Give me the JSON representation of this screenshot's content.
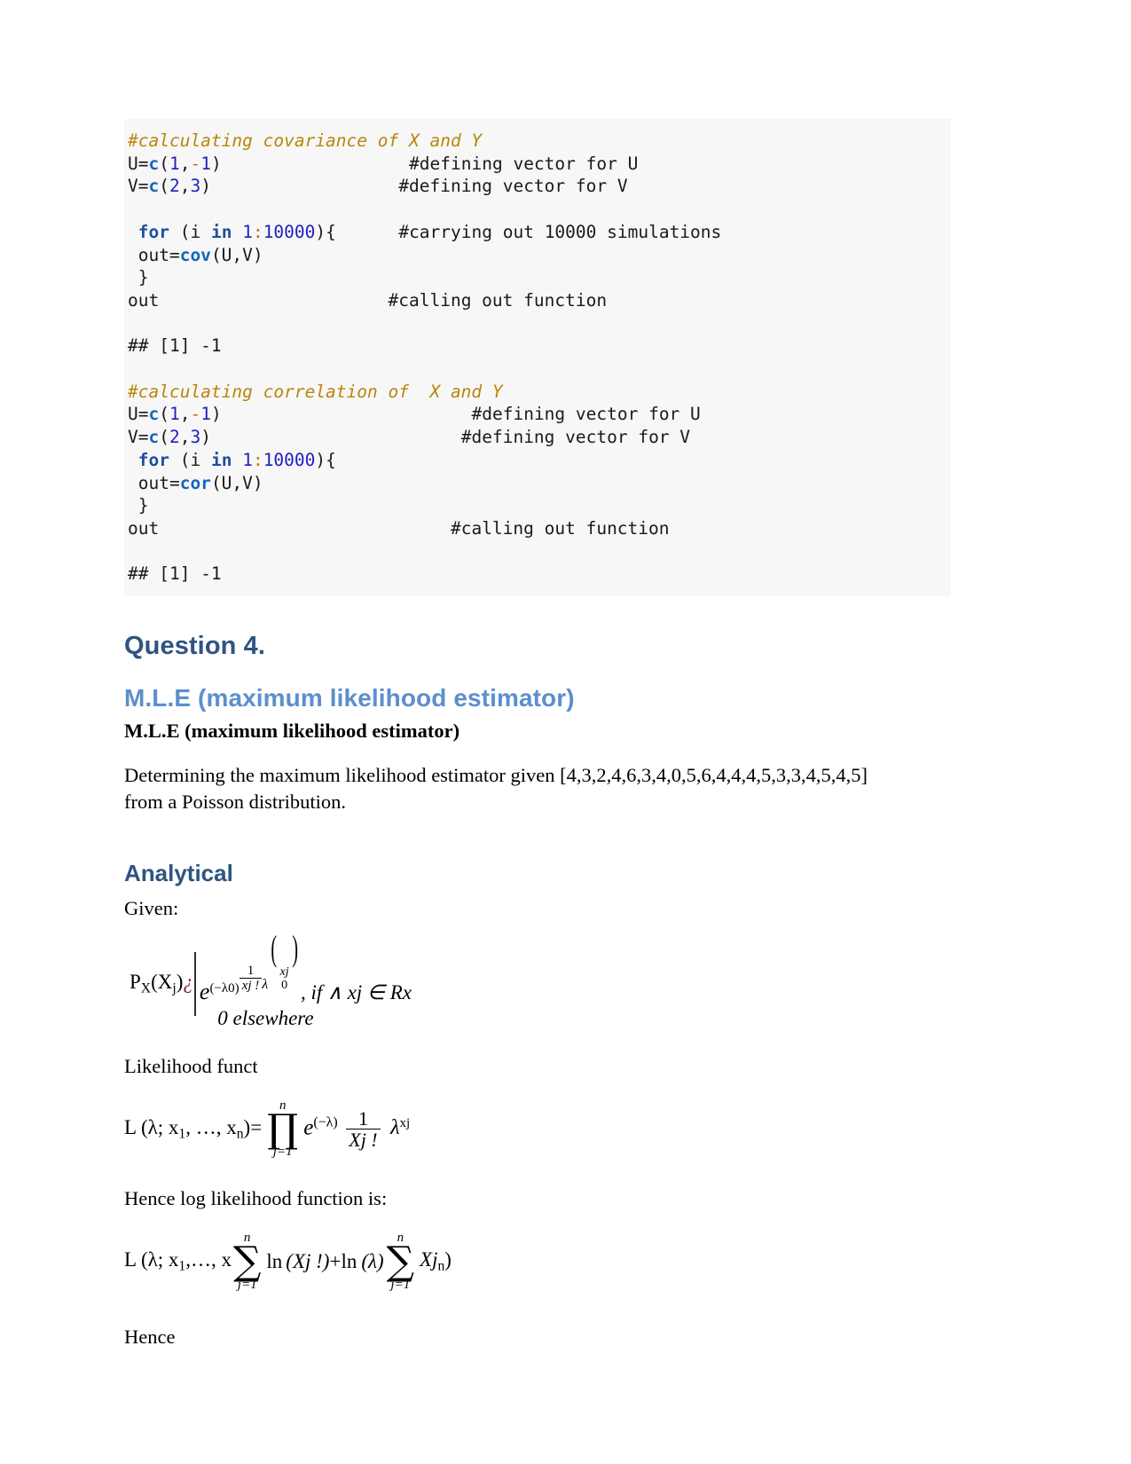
{
  "document": {
    "type": "r-markdown-statistics-assignment"
  },
  "code_block_1": {
    "language": "R",
    "background": "#f7f7f7",
    "lines": [
      {
        "segments": [
          {
            "t": "#calculating covariance of X and Y",
            "c": "cmt"
          }
        ]
      },
      {
        "segments": [
          {
            "t": "U=",
            "c": "out"
          },
          {
            "t": "c",
            "c": "fn"
          },
          {
            "t": "(",
            "c": "out"
          },
          {
            "t": "1",
            "c": "num"
          },
          {
            "t": ",",
            "c": "out"
          },
          {
            "t": "-",
            "c": "op"
          },
          {
            "t": "1",
            "c": "num"
          },
          {
            "t": ")",
            "c": "out"
          },
          {
            "t": "                  ",
            "c": "out"
          },
          {
            "t": "#defining vector for U",
            "c": "cmt-r"
          }
        ]
      },
      {
        "segments": [
          {
            "t": "V=",
            "c": "out"
          },
          {
            "t": "c",
            "c": "fn"
          },
          {
            "t": "(",
            "c": "out"
          },
          {
            "t": "2",
            "c": "num"
          },
          {
            "t": ",",
            "c": "out"
          },
          {
            "t": "3",
            "c": "num"
          },
          {
            "t": ")",
            "c": "out"
          },
          {
            "t": "                  ",
            "c": "out"
          },
          {
            "t": "#defining vector for V",
            "c": "cmt-r"
          }
        ]
      },
      {
        "segments": []
      },
      {
        "segments": [
          {
            "t": " ",
            "c": "out"
          },
          {
            "t": "for",
            "c": "kw"
          },
          {
            "t": " (i ",
            "c": "out"
          },
          {
            "t": "in",
            "c": "kw"
          },
          {
            "t": " ",
            "c": "out"
          },
          {
            "t": "1",
            "c": "num"
          },
          {
            "t": ":",
            "c": "op"
          },
          {
            "t": "10000",
            "c": "num"
          },
          {
            "t": "){",
            "c": "out"
          },
          {
            "t": "      ",
            "c": "out"
          },
          {
            "t": "#carrying out 10000 simulations",
            "c": "cmt-r"
          }
        ]
      },
      {
        "segments": [
          {
            "t": " out=",
            "c": "out"
          },
          {
            "t": "cov",
            "c": "fn"
          },
          {
            "t": "(U,V)",
            "c": "out"
          }
        ]
      },
      {
        "segments": [
          {
            "t": " }",
            "c": "out"
          }
        ]
      },
      {
        "segments": [
          {
            "t": "out",
            "c": "out"
          },
          {
            "t": "                      ",
            "c": "out"
          },
          {
            "t": "#calling out function",
            "c": "cmt-r"
          }
        ]
      },
      {
        "segments": []
      },
      {
        "segments": [
          {
            "t": "## [1] -1",
            "c": "out"
          }
        ]
      },
      {
        "segments": []
      },
      {
        "segments": [
          {
            "t": "#calculating correlation of  X and Y",
            "c": "cmt"
          }
        ]
      },
      {
        "segments": [
          {
            "t": "U=",
            "c": "out"
          },
          {
            "t": "c",
            "c": "fn"
          },
          {
            "t": "(",
            "c": "out"
          },
          {
            "t": "1",
            "c": "num"
          },
          {
            "t": ",",
            "c": "out"
          },
          {
            "t": "-",
            "c": "op"
          },
          {
            "t": "1",
            "c": "num"
          },
          {
            "t": ")",
            "c": "out"
          },
          {
            "t": "                        ",
            "c": "out"
          },
          {
            "t": "#defining vector for U",
            "c": "cmt-r"
          }
        ]
      },
      {
        "segments": [
          {
            "t": "V=",
            "c": "out"
          },
          {
            "t": "c",
            "c": "fn"
          },
          {
            "t": "(",
            "c": "out"
          },
          {
            "t": "2",
            "c": "num"
          },
          {
            "t": ",",
            "c": "out"
          },
          {
            "t": "3",
            "c": "num"
          },
          {
            "t": ")",
            "c": "out"
          },
          {
            "t": "                        ",
            "c": "out"
          },
          {
            "t": "#defining vector for V",
            "c": "cmt-r"
          }
        ]
      },
      {
        "segments": [
          {
            "t": " ",
            "c": "out"
          },
          {
            "t": "for",
            "c": "kw"
          },
          {
            "t": " (i ",
            "c": "out"
          },
          {
            "t": "in",
            "c": "kw"
          },
          {
            "t": " ",
            "c": "out"
          },
          {
            "t": "1",
            "c": "num"
          },
          {
            "t": ":",
            "c": "op"
          },
          {
            "t": "10000",
            "c": "num"
          },
          {
            "t": "){",
            "c": "out"
          }
        ]
      },
      {
        "segments": [
          {
            "t": " out=",
            "c": "out"
          },
          {
            "t": "cor",
            "c": "fn"
          },
          {
            "t": "(U,V)",
            "c": "out"
          }
        ]
      },
      {
        "segments": [
          {
            "t": " }",
            "c": "out"
          }
        ]
      },
      {
        "segments": [
          {
            "t": "out",
            "c": "out"
          },
          {
            "t": "                            ",
            "c": "out"
          },
          {
            "t": "#calling out function",
            "c": "cmt-r"
          }
        ]
      },
      {
        "segments": []
      },
      {
        "segments": [
          {
            "t": "## [1] -1",
            "c": "out"
          }
        ]
      }
    ]
  },
  "headings": {
    "question": "Question 4.",
    "mle_blue": "M.L.E (maximum likelihood estimator)",
    "mle_serif": "M.L.E (maximum likelihood estimator)",
    "analytical": "Analytical"
  },
  "paragraphs": {
    "intro_line1": "Determining the maximum likelihood estimator given [4,3,2,4,6,3,4,0,5,6,4,4,4,5,3,3,4,5,4,5]",
    "intro_line2": "from a Poisson distribution.",
    "given": "Given:",
    "likelihood_funct": "Likelihood funct",
    "hence_log": "Hence log likelihood function is:",
    "hence": "Hence"
  },
  "formulas": {
    "pmf": {
      "lhs_p": "P",
      "lhs_p_sub": "X",
      "lhs_open": "(X",
      "lhs_sub_j": "j",
      "lhs_close": ")",
      "error_mark": "¿",
      "e": "e",
      "exp_neg_lambda0": "(−λ0)",
      "frac_num": "1",
      "frac_den": "xj !",
      "lambda": "λ",
      "vec_top": "xj",
      "vec_bot": "0",
      "condition": ", if ∧ xj ∈ Rx",
      "elsewhere": "0 elsewhere"
    },
    "likelihood": {
      "lhs": "L (λ; x",
      "lhs_sub1": "1",
      "lhs_mid": ", …, x",
      "lhs_subn": "n",
      "lhs_eq": ")=",
      "prod_top": "n",
      "prod_glyph": "∏",
      "prod_bot": "j=1",
      "e": "e",
      "e_sup": "(−λ)",
      "frac_num": "1",
      "frac_den": "Xj !",
      "lambda": "λ",
      "lambda_sup": "xj"
    },
    "loglikelihood": {
      "lhs": "L (λ; x",
      "lhs_sub1": "1",
      "lhs_mid": ",…, x",
      "sum_top": "n",
      "sum_glyph": "∑",
      "sum_bot": "j=1",
      "ln1": "ln",
      "ln1_arg": "(Xj !)",
      "plus": "+",
      "ln2": "ln",
      "ln2_arg": "(λ)",
      "sum2_top": "n",
      "sum2_glyph": "∑",
      "sum2_bot": "j=1",
      "tail": "Xj",
      "tail_sub": "n",
      "close": ")"
    }
  },
  "colors": {
    "code_bg": "#f7f7f7",
    "comment": "#b8860b",
    "keyword": "#1f4e9c",
    "function": "#1565c0",
    "number": "#2020c0",
    "operator": "#d2691e",
    "heading_dark_blue": "#2e5481",
    "heading_light_blue": "#5b8fcc",
    "error_mark": "#8b1a2b"
  }
}
